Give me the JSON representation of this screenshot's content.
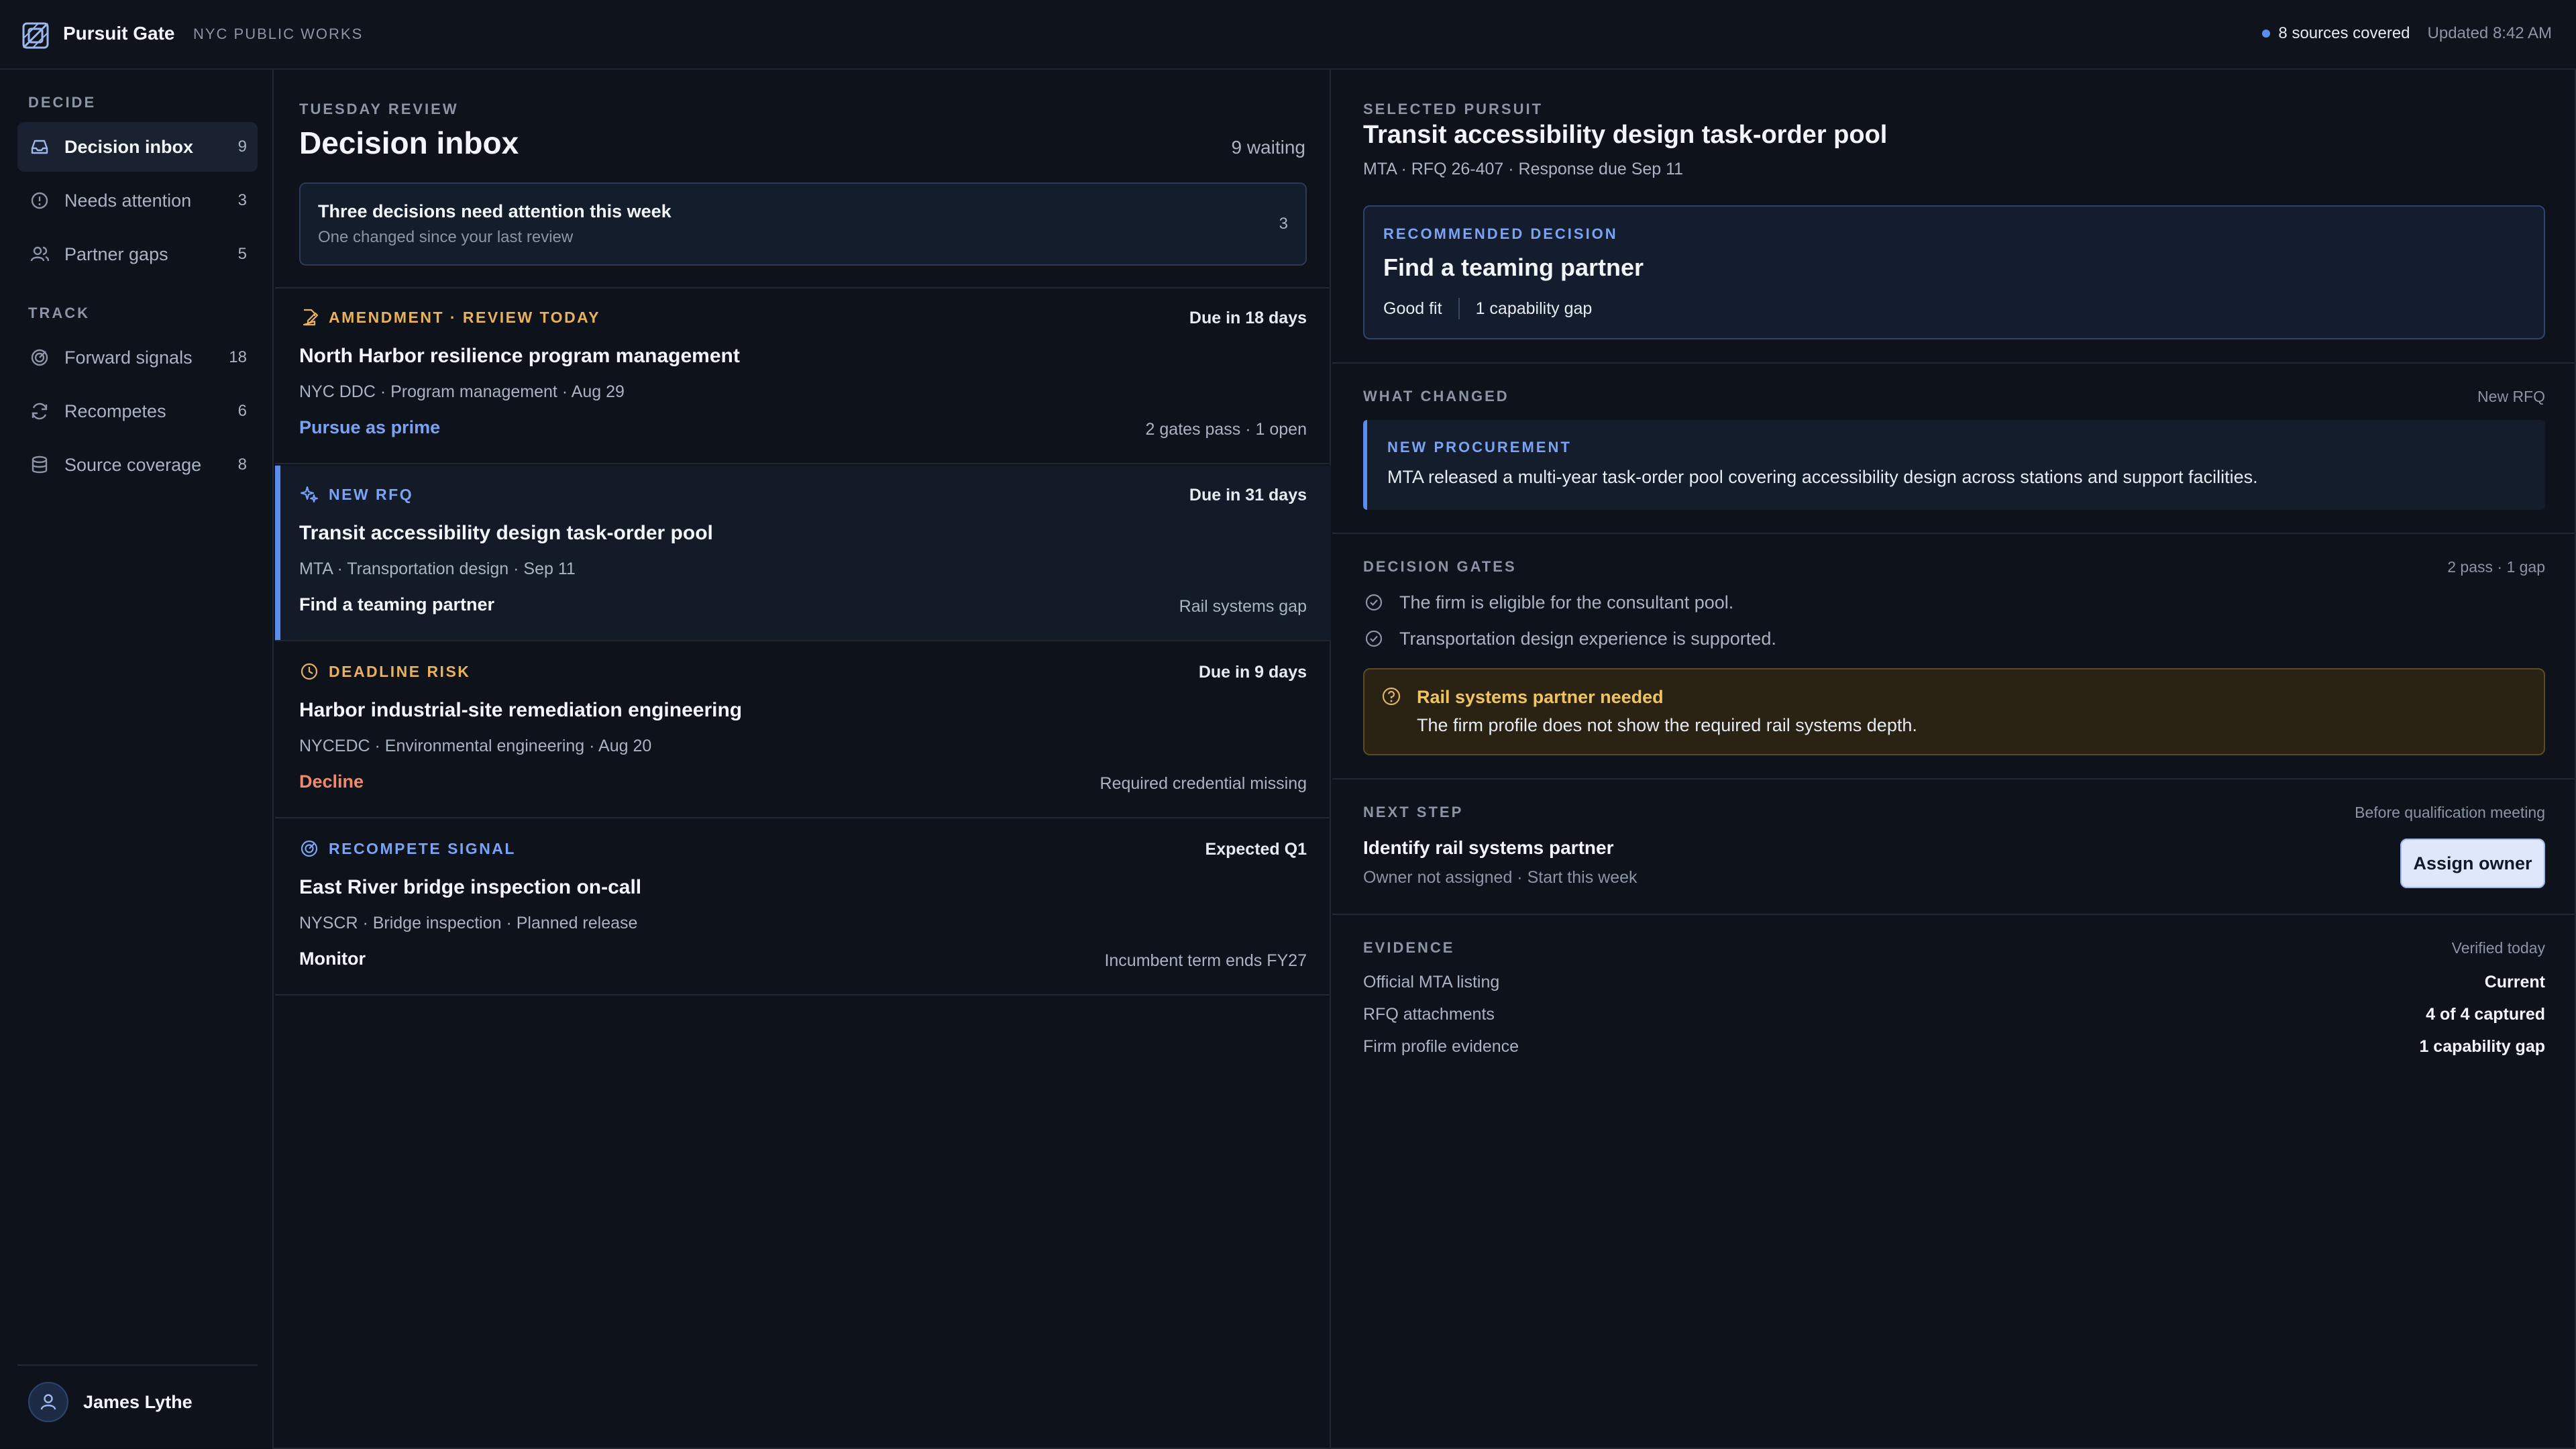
{
  "topbar": {
    "brand": "Pursuit Gate",
    "org": "NYC PUBLIC WORKS",
    "sources": "8 sources covered",
    "updated": "Updated 8:42 AM"
  },
  "sidebar": {
    "decide_label": "DECIDE",
    "track_label": "TRACK",
    "decide_items": [
      {
        "label": "Decision inbox",
        "count": "9",
        "icon": "inbox-icon"
      },
      {
        "label": "Needs attention",
        "count": "3",
        "icon": "alert-circle-icon"
      },
      {
        "label": "Partner gaps",
        "count": "5",
        "icon": "users-icon"
      }
    ],
    "track_items": [
      {
        "label": "Forward signals",
        "count": "18",
        "icon": "radar-icon"
      },
      {
        "label": "Recompetes",
        "count": "6",
        "icon": "refresh-icon"
      },
      {
        "label": "Source coverage",
        "count": "8",
        "icon": "database-icon"
      }
    ],
    "user_name": "James Lythe"
  },
  "inbox": {
    "eyebrow": "TUESDAY REVIEW",
    "title": "Decision inbox",
    "waiting": "9 waiting",
    "callout_title": "Three decisions need attention this week",
    "callout_sub": "One changed since your last review",
    "callout_count": "3",
    "cards": [
      {
        "tag": "AMENDMENT · REVIEW TODAY",
        "due": "Due in 18 days",
        "title": "North Harbor resilience program management",
        "meta": "NYC DDC · Program management · Aug 29",
        "action": "Pursue as prime",
        "note": "2 gates pass · 1 open"
      },
      {
        "tag": "NEW RFQ",
        "due": "Due in 31 days",
        "title": "Transit accessibility design task-order pool",
        "meta": "MTA · Transportation design · Sep 11",
        "action": "Find a teaming partner",
        "note": "Rail systems gap"
      },
      {
        "tag": "DEADLINE RISK",
        "due": "Due in 9 days",
        "title": "Harbor industrial-site remediation engineering",
        "meta": "NYCEDC · Environmental engineering · Aug 20",
        "action": "Decline",
        "note": "Required credential missing"
      },
      {
        "tag": "RECOMPETE SIGNAL",
        "due": "Expected Q1",
        "title": "East River bridge inspection on-call",
        "meta": "NYSCR · Bridge inspection · Planned release",
        "action": "Monitor",
        "note": "Incumbent term ends FY27"
      }
    ]
  },
  "detail": {
    "eyebrow": "SELECTED PURSUIT",
    "title": "Transit accessibility design task-order pool",
    "meta": "MTA · RFQ 26-407 · Response due Sep 11",
    "rec_eyebrow": "RECOMMENDED DECISION",
    "rec_title": "Find a teaming partner",
    "rec_fit": "Good fit",
    "rec_gap": "1 capability gap",
    "changed_label": "WHAT CHANGED",
    "changed_side": "New RFQ",
    "changed_eyebrow": "NEW PROCUREMENT",
    "changed_text": "MTA released a multi-year task-order pool covering accessibility design across stations and support facilities.",
    "gates_label": "DECISION GATES",
    "gates_side": "2 pass · 1 gap",
    "gates": [
      "The firm is eligible for the consultant pool.",
      "Transportation design experience is supported."
    ],
    "warn_title": "Rail systems partner needed",
    "warn_text": "The firm profile does not show the required rail systems depth.",
    "next_label": "NEXT STEP",
    "next_side": "Before qualification meeting",
    "next_title": "Identify rail systems partner",
    "next_meta": "Owner not assigned · Start this week",
    "assign_label": "Assign owner",
    "evidence_label": "EVIDENCE",
    "evidence_side": "Verified today",
    "evidence": [
      {
        "k": "Official MTA listing",
        "v": "Current"
      },
      {
        "k": "RFQ attachments",
        "v": "4 of 4 captured"
      },
      {
        "k": "Firm profile evidence",
        "v": "1 capability gap"
      }
    ]
  },
  "colors": {
    "accent": "#5b8def",
    "amber": "#e8b25a",
    "decline": "#f08a6d",
    "background": "#0d121b"
  }
}
